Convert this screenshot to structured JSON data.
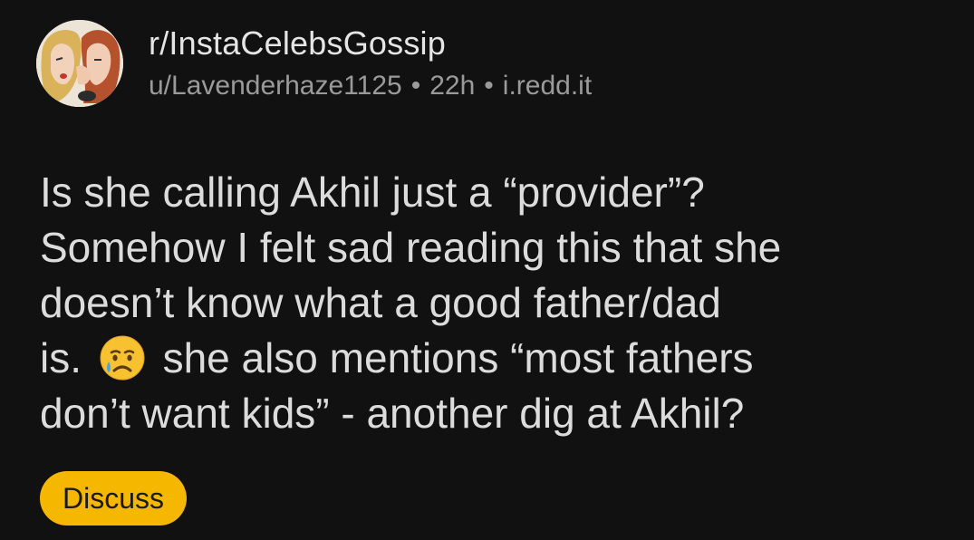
{
  "post": {
    "subreddit": "r/InstaCelebsGossip",
    "author": "u/Lavenderhaze1125",
    "age": "22h",
    "domain": "i.redd.it",
    "separator": "•",
    "title_lines": [
      "Is she calling Akhil just a “provider”?",
      "Somehow I felt sad reading this that she",
      "doesn’t know what a good father/dad",
      "is.",
      "she also mentions “most fathers",
      "don’t want kids” - another dig at Akhil?"
    ],
    "emoji": "crying-face-emoji",
    "discuss_label": "Discuss"
  },
  "colors": {
    "background": "#111111",
    "text": "#dcdcdc",
    "meta_text": "#9a9a9a",
    "accent_button": "#f5b700"
  },
  "icons": {
    "avatar": "subreddit-avatar-two-women-whispering"
  }
}
